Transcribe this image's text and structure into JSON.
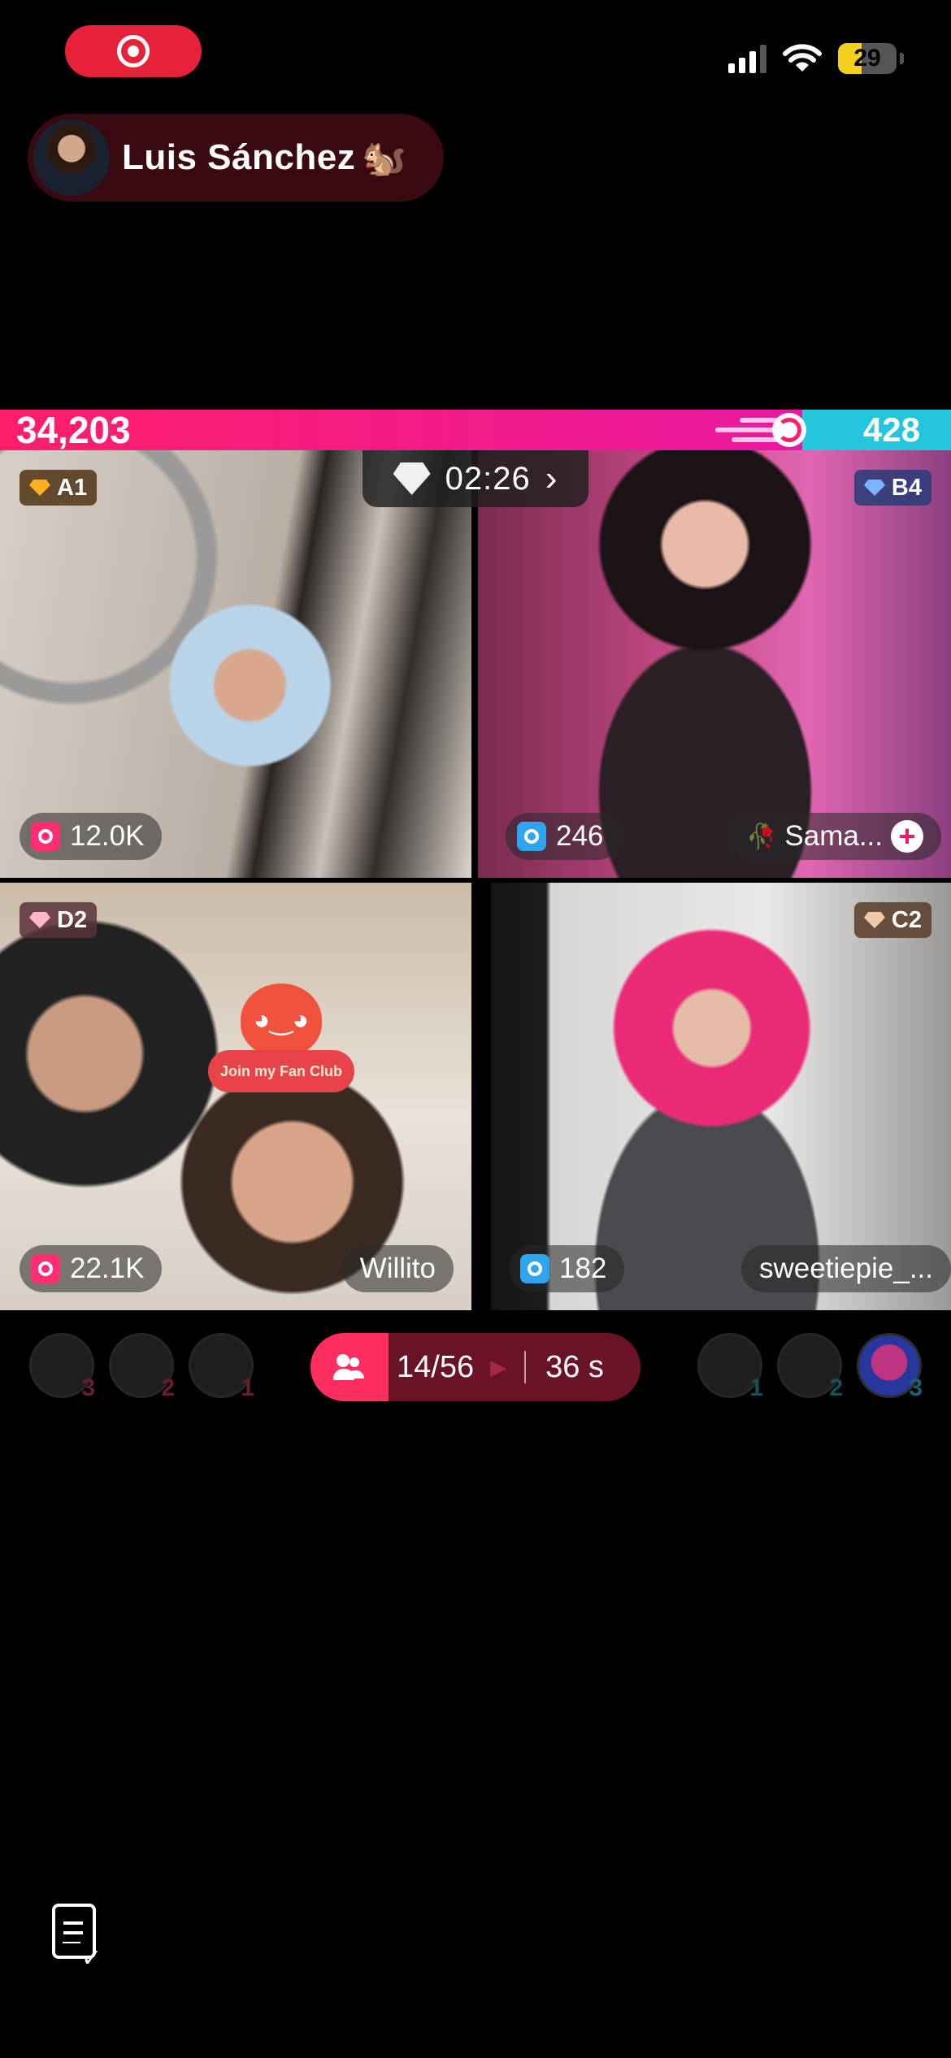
{
  "status_bar": {
    "battery": "29",
    "battery_level": 0.29,
    "icons": [
      "screen-record-icon",
      "signal-icon",
      "wifi-icon",
      "battery-icon"
    ]
  },
  "host": {
    "name": "Luis Sánchez",
    "emoji": "🐿️"
  },
  "battle": {
    "left_score": "34,203",
    "right_score": "428",
    "timer": "02:26",
    "colors": {
      "left": "#ff1e6a",
      "right": "#24c6dd"
    }
  },
  "tiles": [
    {
      "rank": "A1",
      "gifts": "12.0K",
      "name": ""
    },
    {
      "rank": "B4",
      "gifts": "246",
      "name": "Sama..."
    },
    {
      "rank": "D2",
      "gifts": "22.1K",
      "name": "Willito"
    },
    {
      "rank": "C2",
      "gifts": "182",
      "name": "sweetiepie_..."
    }
  ],
  "fan_club": {
    "label": "Join my Fan Club"
  },
  "bottom_row": {
    "left_viewers": [
      {
        "rank": "3"
      },
      {
        "rank": "2"
      },
      {
        "rank": "1"
      }
    ],
    "right_viewers": [
      {
        "rank": "1"
      },
      {
        "rank": "2"
      },
      {
        "rank": "3"
      }
    ],
    "counter": "14/56",
    "countdown": "36 s"
  }
}
